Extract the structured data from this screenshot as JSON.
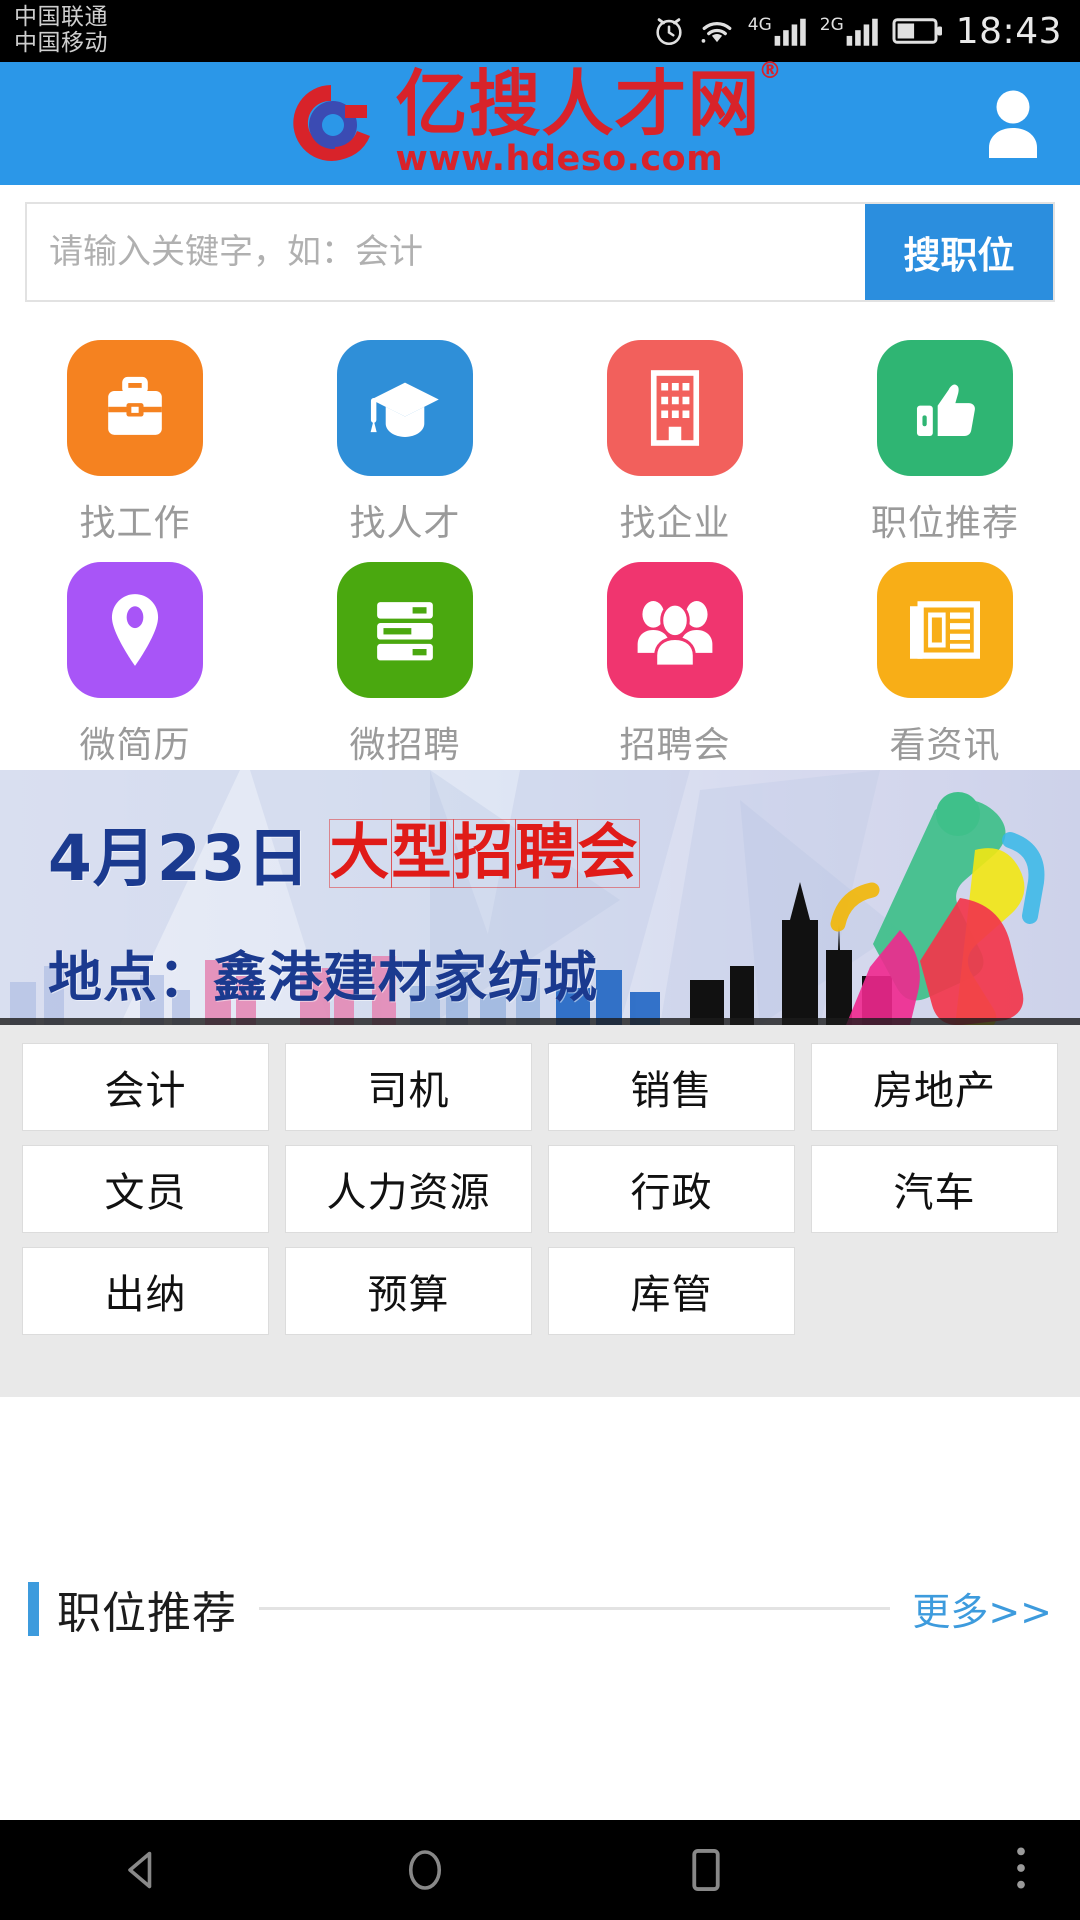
{
  "status_bar": {
    "carriers": [
      "中国联通",
      "中国移动"
    ],
    "time": "18:43",
    "icons": [
      "alarm-icon",
      "wifi-icon",
      "signal-4g-icon",
      "signal-2g-icon",
      "battery-icon"
    ],
    "network_labels": {
      "primary": "4G",
      "secondary": "2G"
    }
  },
  "header": {
    "logo_title": "亿搜人才网",
    "logo_registered": "®",
    "logo_url": "www.hdeso.com",
    "brand_red": "#d8232a",
    "brand_blue": "#2b97e8",
    "account_icon": "user-icon"
  },
  "search": {
    "placeholder": "请输入关键字，如：会计",
    "value": "",
    "button_label": "搜职位",
    "button_color": "#2b8ede"
  },
  "nav_grid": {
    "rows": [
      [
        {
          "label": "找工作",
          "icon": "briefcase-icon",
          "color": "#f58220"
        },
        {
          "label": "找人才",
          "icon": "graduation-cap-icon",
          "color": "#2f8fd8"
        },
        {
          "label": "找企业",
          "icon": "building-icon",
          "color": "#f2605c"
        },
        {
          "label": "职位推荐",
          "icon": "thumbs-up-icon",
          "color": "#2fb573"
        }
      ],
      [
        {
          "label": "微简历",
          "icon": "location-pin-icon",
          "color": "#a855f7"
        },
        {
          "label": "微招聘",
          "icon": "list-server-icon",
          "color": "#4aa80f"
        },
        {
          "label": "招聘会",
          "icon": "people-group-icon",
          "color": "#f0356f"
        },
        {
          "label": "看资讯",
          "icon": "newspaper-icon",
          "color": "#f8ae17"
        }
      ]
    ]
  },
  "banner": {
    "date": "4月23日",
    "title": "大型招聘会",
    "place": "地点：鑫港建材家纺城",
    "date_color": "#1b3a8f",
    "title_color": "#e01b18"
  },
  "tags": {
    "items": [
      "会计",
      "司机",
      "销售",
      "房地产",
      "文员",
      "人力资源",
      "行政",
      "汽车",
      "出纳",
      "预算",
      "库管"
    ]
  },
  "recommend_section": {
    "title": "职位推荐",
    "more_label": "更多>>",
    "accent_color": "#3d9bdd"
  },
  "system_nav": {
    "back": "back-triangle-icon",
    "home": "home-circle-icon",
    "recents": "recents-square-icon",
    "menu": "overflow-dots-icon"
  }
}
